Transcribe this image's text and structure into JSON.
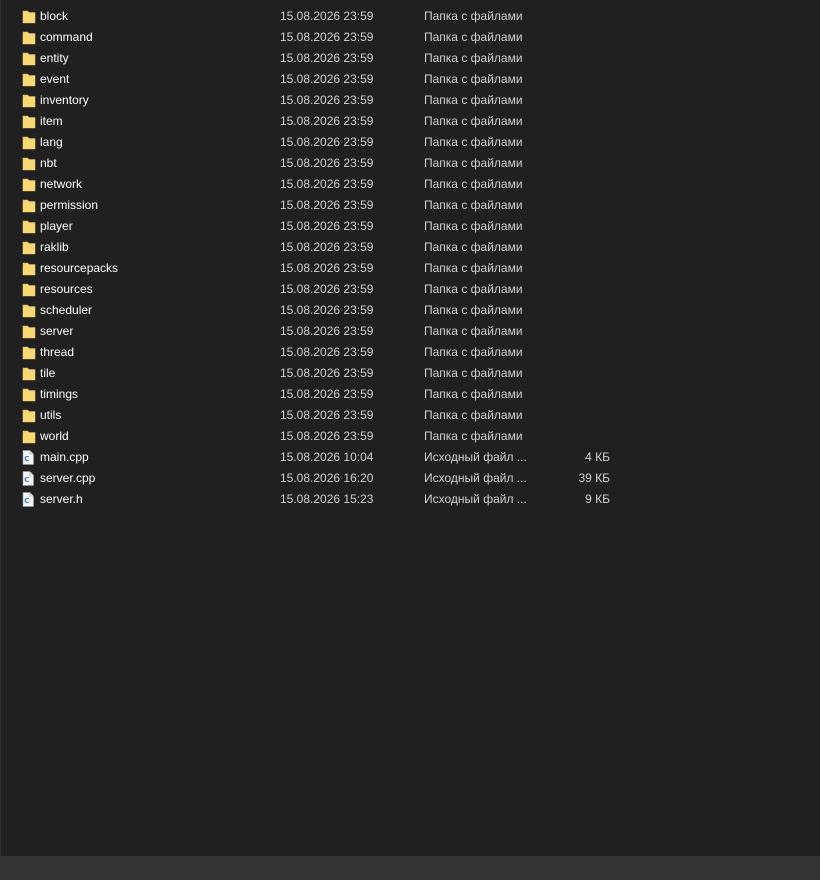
{
  "colors": {
    "background": "#202020",
    "status_bar": "#333333",
    "folder": "#f8d775",
    "text": "#ffffff",
    "secondary_text": "#d0d0d0"
  },
  "files": [
    {
      "name": "block",
      "date": "15.08.2026 23:59",
      "type": "Папка с файлами",
      "size": "",
      "icon": "folder-icon"
    },
    {
      "name": "command",
      "date": "15.08.2026 23:59",
      "type": "Папка с файлами",
      "size": "",
      "icon": "folder-icon"
    },
    {
      "name": "entity",
      "date": "15.08.2026 23:59",
      "type": "Папка с файлами",
      "size": "",
      "icon": "folder-icon"
    },
    {
      "name": "event",
      "date": "15.08.2026 23:59",
      "type": "Папка с файлами",
      "size": "",
      "icon": "folder-icon"
    },
    {
      "name": "inventory",
      "date": "15.08.2026 23:59",
      "type": "Папка с файлами",
      "size": "",
      "icon": "folder-icon"
    },
    {
      "name": "item",
      "date": "15.08.2026 23:59",
      "type": "Папка с файлами",
      "size": "",
      "icon": "folder-icon"
    },
    {
      "name": "lang",
      "date": "15.08.2026 23:59",
      "type": "Папка с файлами",
      "size": "",
      "icon": "folder-icon"
    },
    {
      "name": "nbt",
      "date": "15.08.2026 23:59",
      "type": "Папка с файлами",
      "size": "",
      "icon": "folder-icon"
    },
    {
      "name": "network",
      "date": "15.08.2026 23:59",
      "type": "Папка с файлами",
      "size": "",
      "icon": "folder-icon"
    },
    {
      "name": "permission",
      "date": "15.08.2026 23:59",
      "type": "Папка с файлами",
      "size": "",
      "icon": "folder-icon"
    },
    {
      "name": "player",
      "date": "15.08.2026 23:59",
      "type": "Папка с файлами",
      "size": "",
      "icon": "folder-icon"
    },
    {
      "name": "raklib",
      "date": "15.08.2026 23:59",
      "type": "Папка с файлами",
      "size": "",
      "icon": "folder-icon"
    },
    {
      "name": "resourcepacks",
      "date": "15.08.2026 23:59",
      "type": "Папка с файлами",
      "size": "",
      "icon": "folder-icon"
    },
    {
      "name": "resources",
      "date": "15.08.2026 23:59",
      "type": "Папка с файлами",
      "size": "",
      "icon": "folder-icon"
    },
    {
      "name": "scheduler",
      "date": "15.08.2026 23:59",
      "type": "Папка с файлами",
      "size": "",
      "icon": "folder-icon"
    },
    {
      "name": "server",
      "date": "15.08.2026 23:59",
      "type": "Папка с файлами",
      "size": "",
      "icon": "folder-icon"
    },
    {
      "name": "thread",
      "date": "15.08.2026 23:59",
      "type": "Папка с файлами",
      "size": "",
      "icon": "folder-icon"
    },
    {
      "name": "tile",
      "date": "15.08.2026 23:59",
      "type": "Папка с файлами",
      "size": "",
      "icon": "folder-icon"
    },
    {
      "name": "timings",
      "date": "15.08.2026 23:59",
      "type": "Папка с файлами",
      "size": "",
      "icon": "folder-icon"
    },
    {
      "name": "utils",
      "date": "15.08.2026 23:59",
      "type": "Папка с файлами",
      "size": "",
      "icon": "folder-icon"
    },
    {
      "name": "world",
      "date": "15.08.2026 23:59",
      "type": "Папка с файлами",
      "size": "",
      "icon": "folder-icon"
    },
    {
      "name": "main.cpp",
      "date": "15.08.2026 10:04",
      "type": "Исходный файл ...",
      "size": "4 КБ",
      "icon": "cpp-file-icon"
    },
    {
      "name": "server.cpp",
      "date": "15.08.2026 16:20",
      "type": "Исходный файл ...",
      "size": "39 КБ",
      "icon": "cpp-file-icon"
    },
    {
      "name": "server.h",
      "date": "15.08.2026 15:23",
      "type": "Исходный файл ...",
      "size": "9 КБ",
      "icon": "c-header-file-icon"
    }
  ]
}
